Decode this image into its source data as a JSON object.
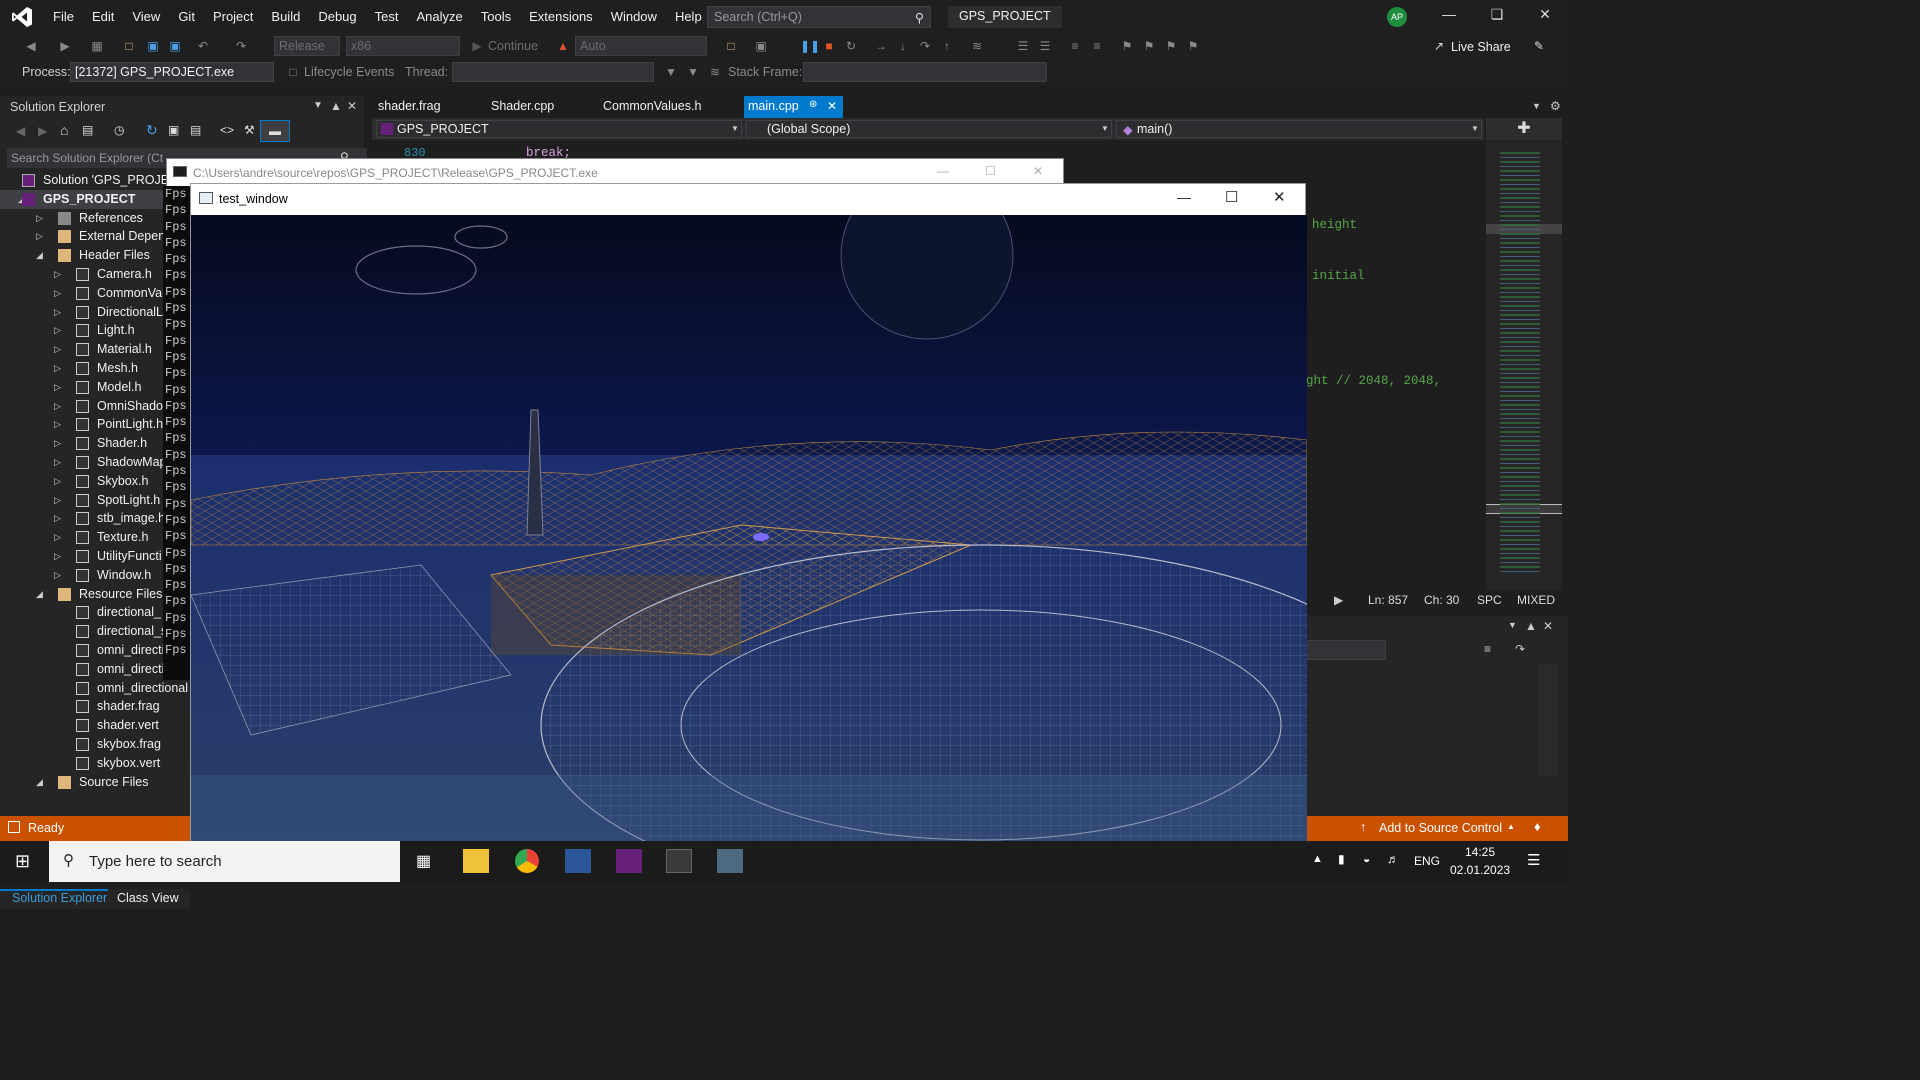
{
  "menu": [
    "File",
    "Edit",
    "View",
    "Git",
    "Project",
    "Build",
    "Debug",
    "Test",
    "Analyze",
    "Tools",
    "Extensions",
    "Window",
    "Help"
  ],
  "search": {
    "placeholder": "Search (Ctrl+Q)"
  },
  "project_title": "GPS_PROJECT",
  "avatar_initials": "AP",
  "toolbar": {
    "config": "Release",
    "platform": "x86",
    "continue_label": "Continue",
    "auto_label": "Auto",
    "live_share": "Live Share"
  },
  "debug_bar": {
    "process_label": "Process:",
    "process_value": "[21372] GPS_PROJECT.exe",
    "lifecycle_label": "Lifecycle Events",
    "thread_label": "Thread:",
    "stack_label": "Stack Frame:"
  },
  "solution_explorer": {
    "title": "Solution Explorer",
    "search_placeholder": "Search Solution Explorer (Ct",
    "items": [
      {
        "label": "Solution 'GPS_PROJECT",
        "level": 0,
        "icon": "sol",
        "arrow": ""
      },
      {
        "label": "GPS_PROJECT",
        "level": 0,
        "icon": "proj",
        "arrow": "open",
        "bold": true
      },
      {
        "label": "References",
        "level": 1,
        "icon": "ref",
        "arrow": "closed"
      },
      {
        "label": "External Depen",
        "level": 1,
        "icon": "folder",
        "arrow": "closed"
      },
      {
        "label": "Header Files",
        "level": 1,
        "icon": "folder",
        "arrow": "open"
      },
      {
        "label": "Camera.h",
        "level": 2,
        "icon": "file",
        "arrow": "closed"
      },
      {
        "label": "CommonVal",
        "level": 2,
        "icon": "file",
        "arrow": "closed"
      },
      {
        "label": "DirectionalL",
        "level": 2,
        "icon": "file",
        "arrow": "closed"
      },
      {
        "label": "Light.h",
        "level": 2,
        "icon": "file",
        "arrow": "closed"
      },
      {
        "label": "Material.h",
        "level": 2,
        "icon": "file",
        "arrow": "closed"
      },
      {
        "label": "Mesh.h",
        "level": 2,
        "icon": "file",
        "arrow": "closed"
      },
      {
        "label": "Model.h",
        "level": 2,
        "icon": "file",
        "arrow": "closed"
      },
      {
        "label": "OmniShado",
        "level": 2,
        "icon": "file",
        "arrow": "closed"
      },
      {
        "label": "PointLight.h",
        "level": 2,
        "icon": "file",
        "arrow": "closed"
      },
      {
        "label": "Shader.h",
        "level": 2,
        "icon": "file",
        "arrow": "closed"
      },
      {
        "label": "ShadowMap",
        "level": 2,
        "icon": "file",
        "arrow": "closed"
      },
      {
        "label": "Skybox.h",
        "level": 2,
        "icon": "file",
        "arrow": "closed"
      },
      {
        "label": "SpotLight.h",
        "level": 2,
        "icon": "file",
        "arrow": "closed"
      },
      {
        "label": "stb_image.h",
        "level": 2,
        "icon": "file",
        "arrow": "closed"
      },
      {
        "label": "Texture.h",
        "level": 2,
        "icon": "file",
        "arrow": "closed"
      },
      {
        "label": "UtilityFuncti",
        "level": 2,
        "icon": "file",
        "arrow": "closed"
      },
      {
        "label": "Window.h",
        "level": 2,
        "icon": "file",
        "arrow": "closed"
      },
      {
        "label": "Resource Files",
        "level": 1,
        "icon": "folder",
        "arrow": "open"
      },
      {
        "label": "directional_",
        "level": 2,
        "icon": "file",
        "arrow": ""
      },
      {
        "label": "directional_s",
        "level": 2,
        "icon": "file",
        "arrow": ""
      },
      {
        "label": "omni_directi",
        "level": 2,
        "icon": "file",
        "arrow": ""
      },
      {
        "label": "omni_directi",
        "level": 2,
        "icon": "file",
        "arrow": ""
      },
      {
        "label": "omni_directional",
        "level": 2,
        "icon": "file",
        "arrow": ""
      },
      {
        "label": "shader.frag",
        "level": 2,
        "icon": "file",
        "arrow": ""
      },
      {
        "label": "shader.vert",
        "level": 2,
        "icon": "file",
        "arrow": ""
      },
      {
        "label": "skybox.frag",
        "level": 2,
        "icon": "file",
        "arrow": ""
      },
      {
        "label": "skybox.vert",
        "level": 2,
        "icon": "file",
        "arrow": ""
      },
      {
        "label": "Source Files",
        "level": 1,
        "icon": "folder",
        "arrow": "open"
      }
    ],
    "bottom_tabs": [
      "Solution Explorer",
      "Class View"
    ]
  },
  "editor": {
    "tabs": [
      "shader.frag",
      "Shader.cpp",
      "CommonValues.h",
      "main.cpp"
    ],
    "nav_project": "GPS_PROJECT",
    "nav_scope": "(Global Scope)",
    "nav_function": "main()",
    "partial_line_no": "830",
    "partial_code": "break;",
    "code_fragments": [
      "height",
      "initial",
      "ght // 2048, 2048,"
    ],
    "status": {
      "ln": "Ln: 857",
      "ch": "Ch: 30",
      "spc": "SPC",
      "mixed": "MIXED"
    }
  },
  "console": {
    "title": "C:\\Users\\andre\\source\\repos\\GPS_PROJECT\\Release\\GPS_PROJECT.exe",
    "fps_label": "Fps"
  },
  "test_window": {
    "title": "test_window"
  },
  "statusbar": {
    "ready": "Ready",
    "source_control": "Add to Source Control"
  },
  "taskbar": {
    "search_placeholder": "Type here to search",
    "lang": "ENG",
    "time": "14:25",
    "date": "02.01.2023"
  }
}
